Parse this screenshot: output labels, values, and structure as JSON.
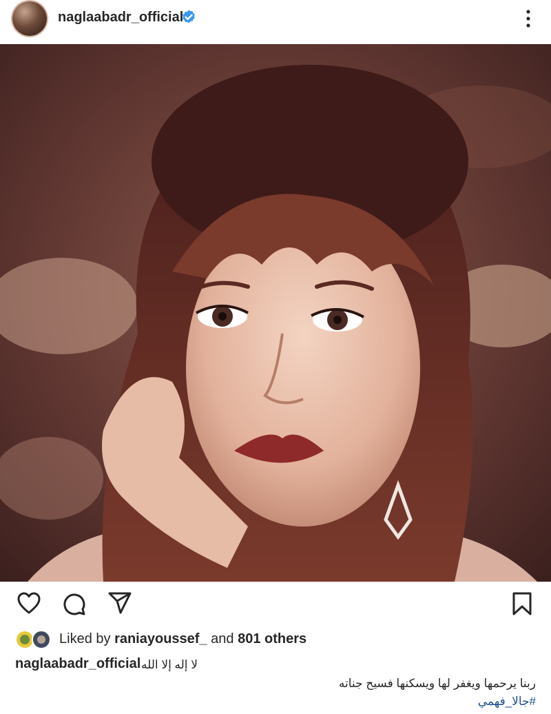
{
  "header": {
    "username": "naglaabadr_official",
    "verified": true,
    "more_icon": "more-vertical-icon"
  },
  "post": {
    "image_alt": "portrait photo"
  },
  "actions": {
    "like_icon": "heart-icon",
    "comment_icon": "comment-icon",
    "share_icon": "send-icon",
    "save_icon": "bookmark-icon"
  },
  "likes": {
    "prefix": "Liked by",
    "user": "raniayoussef_",
    "middle": "and",
    "others": "801 others"
  },
  "caption": {
    "username": "naglaabadr_official",
    "line1": "لا إله إلا الله",
    "line2": "ربنا يرحمها ويغفر لها ويسكنها فسيح جناته",
    "hashtag": "#جالا_فهمي"
  },
  "colors": {
    "text": "#262626",
    "verified": "#3897f0",
    "hashtag": "#1b4e8f"
  }
}
